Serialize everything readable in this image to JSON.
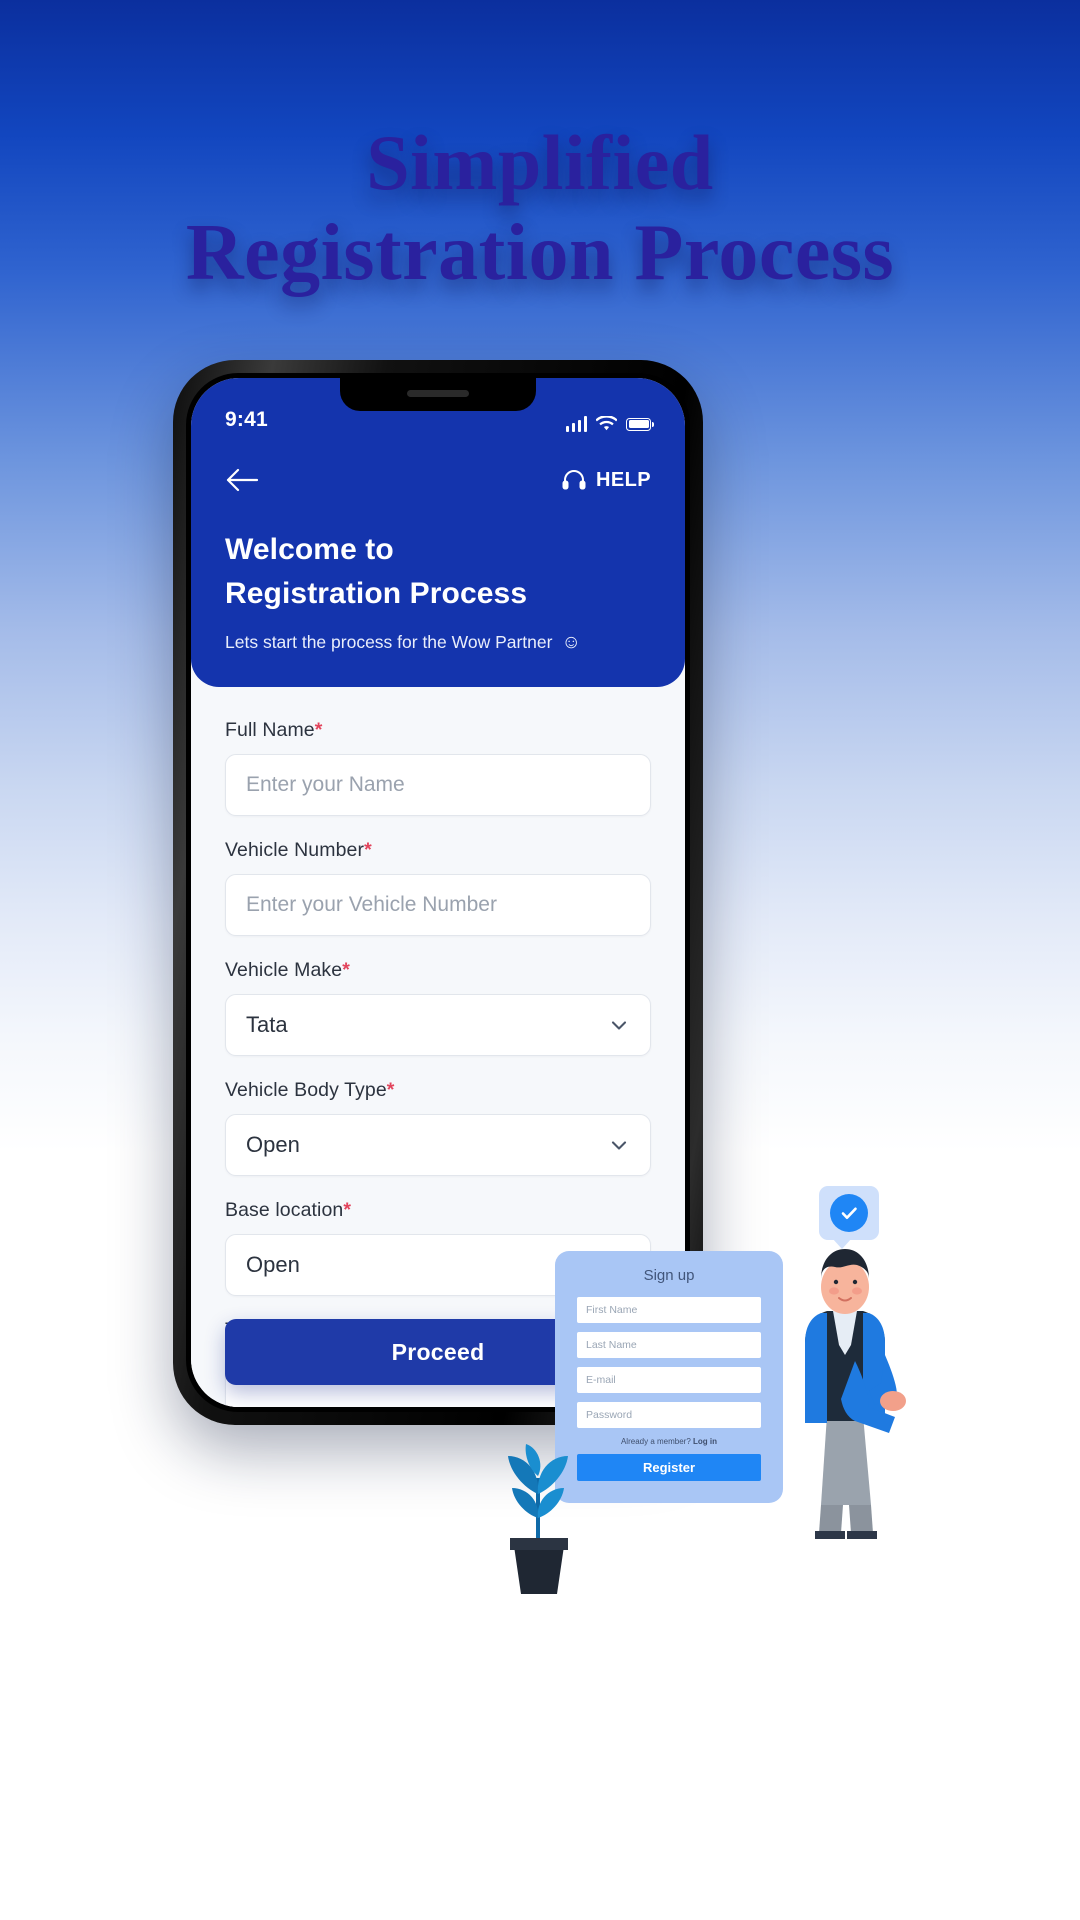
{
  "headline": {
    "line1": "Simplified",
    "line2": "Registration Process"
  },
  "phone": {
    "status": {
      "time": "9:41",
      "signal_icon": "signal-bars-icon",
      "wifi_icon": "wifi-icon",
      "battery_icon": "battery-icon"
    },
    "nav": {
      "back_icon": "back-arrow-icon",
      "help_icon": "headset-icon",
      "help_label": "HELP"
    },
    "header": {
      "welcome_line1": "Welcome to",
      "welcome_line2": "Registration Process",
      "subtitle": "Lets start the process for the Wow Partner",
      "subtitle_emoji": "☺",
      "bg_color": "#1434ad"
    },
    "form": {
      "fields": [
        {
          "label": "Full Name",
          "required": true,
          "type": "text",
          "placeholder": "Enter your Name",
          "value": ""
        },
        {
          "label": "Vehicle Number",
          "required": true,
          "type": "text",
          "placeholder": "Enter your Vehicle Number",
          "value": ""
        },
        {
          "label": "Vehicle Make",
          "required": true,
          "type": "select",
          "value": "Tata"
        },
        {
          "label": "Vehicle Body Type",
          "required": true,
          "type": "select",
          "value": "Open"
        },
        {
          "label": "Base location",
          "required": true,
          "type": "select",
          "value": "Open"
        },
        {
          "label": "Trip Type",
          "required": false,
          "type": "select",
          "value": ""
        }
      ],
      "required_marker": "*"
    },
    "proceed_label": "Proceed",
    "accent_color": "#1f3aa8"
  },
  "signup_card": {
    "title": "Sign up",
    "inputs": [
      {
        "placeholder": "First Name"
      },
      {
        "placeholder": "Last Name"
      },
      {
        "placeholder": "E-mail"
      },
      {
        "placeholder": "Password"
      }
    ],
    "note_text": "Already a member?",
    "note_link": "Log in",
    "register_label": "Register",
    "bg_color": "#a9c6f5",
    "button_color": "#1f86f5"
  },
  "badge": {
    "icon": "check-circle-icon",
    "color": "#1f86f5"
  },
  "illustration": {
    "character": "person-illustration",
    "plant": "potted-plant-illustration"
  }
}
